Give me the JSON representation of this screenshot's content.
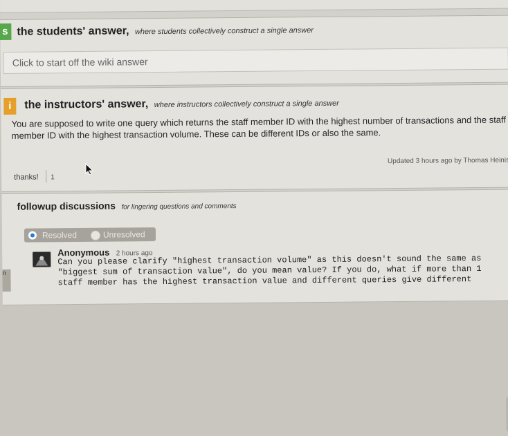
{
  "students": {
    "badge": "s",
    "title": "the students' answer,",
    "subtitle": "where students collectively construct a single answer",
    "placeholder": "Click to start off the wiki answer"
  },
  "instructors": {
    "badge": "i",
    "title": "the instructors' answer,",
    "subtitle": "where instructors collectively construct a single answer",
    "body": "You are supposed to write one query which returns the staff member ID with the highest number of transactions and the staff member ID with the highest transaction volume. These can be different IDs or also the same.",
    "updated": "Updated 3 hours ago by Thomas Heinis",
    "thanks_label": "thanks!",
    "thanks_count": "1"
  },
  "followup": {
    "title": "followup discussions",
    "subtitle": "for lingering questions and comments",
    "filter": {
      "resolved": "Resolved",
      "unresolved": "Unresolved"
    },
    "post": {
      "author": "Anonymous",
      "time": "2 hours ago",
      "body": "Can you please clarify \"highest transaction volume\" as this doesn't sound the same as \"biggest sum of transaction value\", do you mean value? If you do, what if more than 1 staff member has the highest transaction value and different queries give different"
    }
  },
  "edge_text": "n"
}
